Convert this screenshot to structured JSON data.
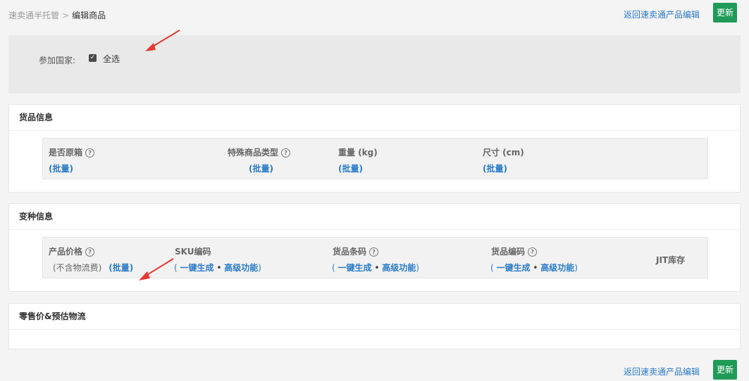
{
  "breadcrumb": {
    "parent": "速卖通半托管",
    "separator": ">",
    "current": "编辑商品"
  },
  "top_actions": {
    "back_link": "返回速卖通产品编辑",
    "update_label": "更新"
  },
  "country": {
    "label": "参加国家:",
    "select_all_label": "全选",
    "select_all_checked": true
  },
  "cargo_info": {
    "title": "货品信息",
    "columns": [
      {
        "header": "是否原箱",
        "has_help": true,
        "action": "(批量)"
      },
      {
        "header": "特殊商品类型",
        "has_help": true,
        "action": "(批量)"
      },
      {
        "header": "重量 (kg)",
        "has_help": false,
        "action": "(批量)"
      },
      {
        "header": "尺寸 (cm)",
        "has_help": false,
        "action": "(批量)"
      }
    ]
  },
  "variant_info": {
    "title": "变种信息",
    "price": {
      "header": "产品价格",
      "note": "(不含物流费)",
      "action": "(批量)"
    },
    "sku": {
      "header": "SKU编码",
      "open": "(",
      "generate": "一键生成",
      "dot": "•",
      "advanced": "高级功能",
      "close": ")"
    },
    "barcode": {
      "header": "货品条码",
      "open": "(",
      "generate": "一键生成",
      "dot": "•",
      "advanced": "高级功能",
      "close": ")"
    },
    "cargo_code": {
      "header": "货品编码",
      "open": "(",
      "generate": "一键生成",
      "dot": "•",
      "advanced": "高级功能",
      "close": ")"
    },
    "jit": {
      "header": "JIT库存"
    }
  },
  "retail": {
    "title": "零售价&预估物流"
  },
  "bottom_actions": {
    "back_link": "返回速卖通产品编辑",
    "update_label": "更新"
  },
  "colors": {
    "primary_button": "#1f9b57",
    "link": "#2a7ac7",
    "annotation_arrow": "#e53935"
  }
}
